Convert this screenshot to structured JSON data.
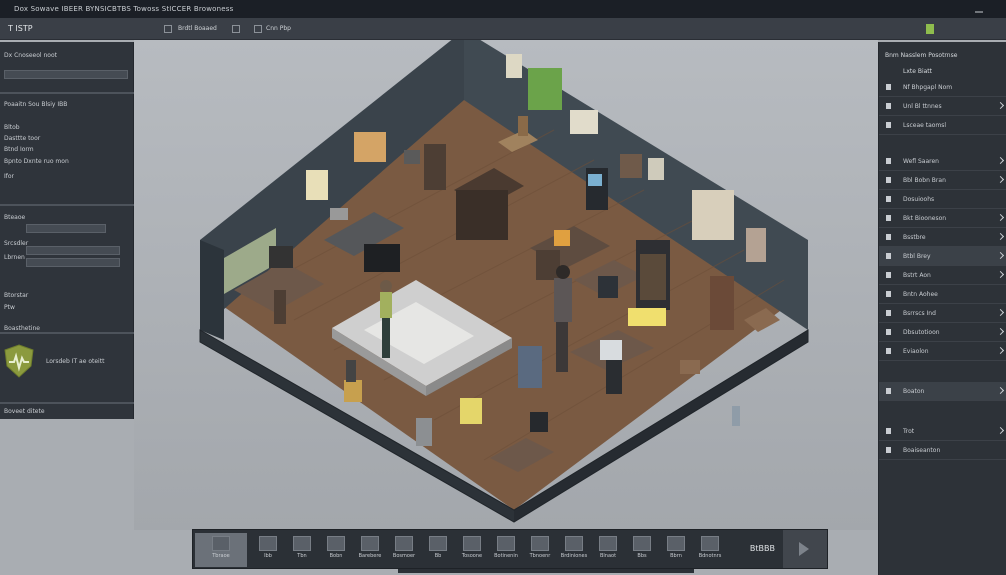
{
  "window": {
    "title": "Dox Sowave IBEER BYNSICBTBS Towoss StICCER Browoness"
  },
  "toolbar": {
    "app_name": "T ISTP",
    "items": [
      "Brdtl Boaaed",
      "Cnn Pbp"
    ]
  },
  "left_panel": {
    "search_label": "Dx Cnoseeol noot",
    "section_title": "Poaaitn Sou Blsiy IBB",
    "rows": [
      "Bltob",
      "Dasttte toor",
      "Btnd Iorm",
      "Bpnto Dxnte ruo mon",
      "Ifor"
    ],
    "sub_rows": [
      "Bteaoe",
      "Srcsdler",
      "Lbrnen"
    ],
    "bottom_rows": [
      "Btorstar",
      "Ptw",
      "Boasthetine"
    ],
    "shield_caption": "Lorsdeb IT ae oteitt",
    "footer": "Boveet ditete"
  },
  "right_panel": {
    "header": "Bnm Nasslem Posotrnse",
    "subheader": "Lxte Biatt",
    "items": [
      "Nf Bhpgapl Nom",
      "Unl Bl ttnnes",
      "Lsceae taomsl",
      "Wefl Saaren",
      "Bbl Bobn Bran",
      "Dosuioohs",
      "Bkt Biooneson",
      "Bsstbre",
      "Btbl Brey",
      "Bstrt Aon",
      "Bntn Aohee",
      "Bsrrscs Ind",
      "Dbsutotioon",
      "Eviaolon",
      "Boaton",
      "Trot",
      "Boaiseanton"
    ]
  },
  "tray": {
    "items": [
      "Tbraoe",
      "Ibb",
      "Tbn",
      "Bobn",
      "Barebere",
      "Bosmoer",
      "Bb",
      "Tosoone",
      "Botinenin",
      "Tbnoenr",
      "Brdiniones",
      "Blnaot",
      "Bbs",
      "Bbrn",
      "Bdnotnrs"
    ],
    "count_label": "BtBBB"
  },
  "colors": {
    "floor": "#7a5a42",
    "wall": "#3b454d",
    "panel": "#2f343b",
    "accent_green": "#8fbd4e",
    "sticky_note": "#f0df6e"
  }
}
